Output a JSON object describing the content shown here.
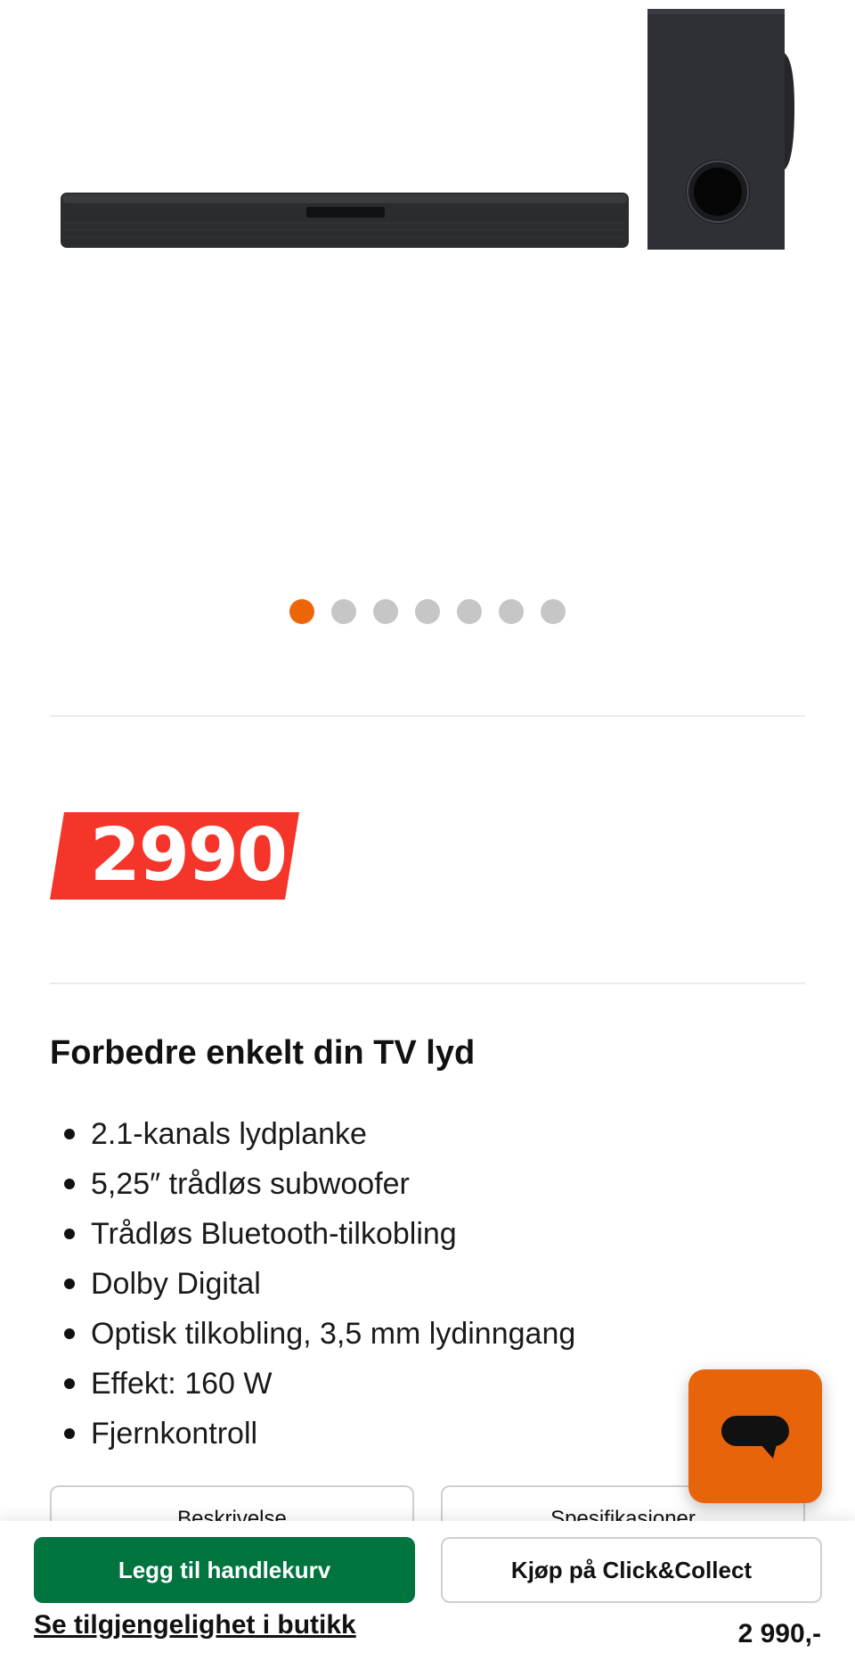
{
  "gallery": {
    "image_label": "LG soundbar with wireless subwoofer",
    "dot_count": 7,
    "active_index": 0,
    "colors": {
      "active": "#ec6608",
      "inactive": "#c6c6c6"
    }
  },
  "price": {
    "tag": "2990",
    "tag_color": "#f5352a"
  },
  "description": {
    "headline": "Forbedre enkelt din TV lyd",
    "bullets": [
      "2.1-kanals lydplanke",
      "5,25″ trådløs subwoofer",
      "Trådløs Bluetooth-tilkobling",
      "Dolby Digital",
      "Optisk tilkobling, 3,5 mm lydinngang",
      "Effekt: 160 W",
      "Fjernkontroll"
    ]
  },
  "tabs": {
    "description": "Beskrivelse",
    "specifications": "Spesifikasjoner"
  },
  "chat": {
    "icon": "chat-bubble-icon",
    "color": "#e8640a"
  },
  "bottom_bar": {
    "add_to_cart": "Legg til handlekurv",
    "click_collect": "Kjøp på Click&Collect",
    "store_availability": "Se tilgjengelighet i butikk",
    "price": "2 990,-",
    "primary_color": "#00743f"
  }
}
